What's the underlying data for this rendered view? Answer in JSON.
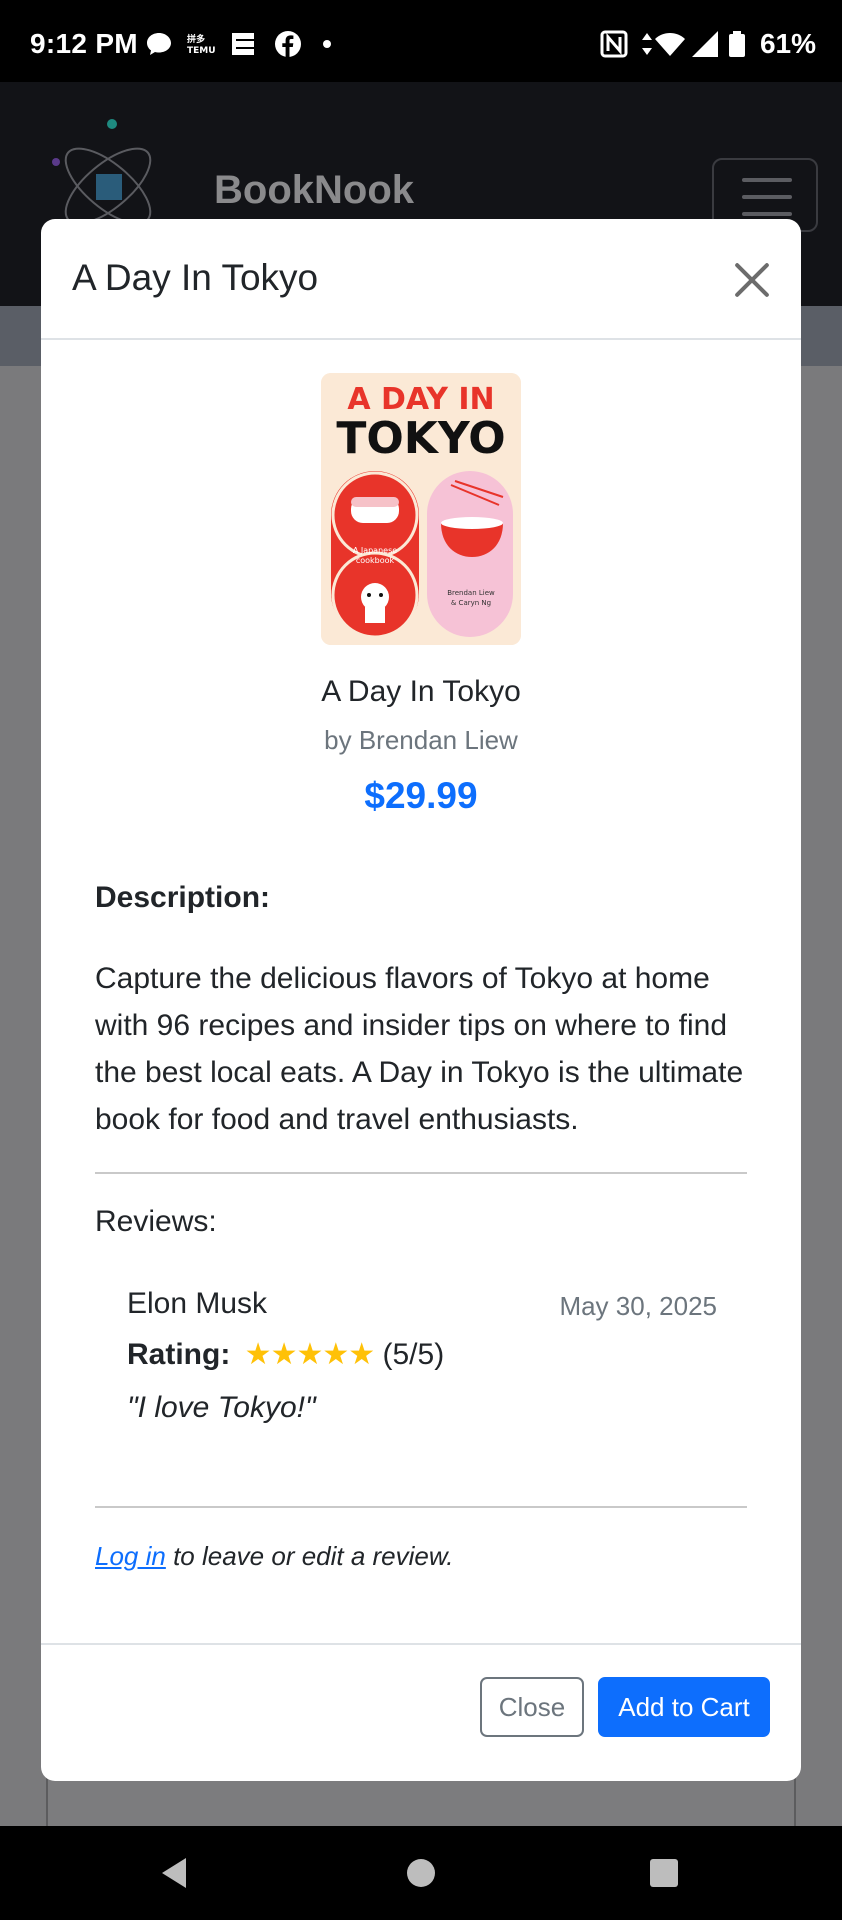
{
  "status_bar": {
    "time": "9:12 PM",
    "battery": "61%",
    "icons": [
      "chat-bubble-icon",
      "temu-icon",
      "news-icon",
      "facebook-icon",
      "dot-icon",
      "nfc-icon",
      "data-arrows-icon",
      "wifi-icon",
      "signal-icon",
      "battery-icon"
    ]
  },
  "app": {
    "brand": "BookNook"
  },
  "modal": {
    "title": "A Day In Tokyo",
    "book": {
      "cover_text_line1": "A DAY IN",
      "cover_text_line2": "TOKYO",
      "cover_small1": "A Japanese cookbook",
      "cover_small2": "Brendan Liew & Caryn Ng",
      "title": "A Day In Tokyo",
      "author": "by Brendan Liew",
      "price": "$29.99"
    },
    "description_label": "Description:",
    "description": "Capture the delicious flavors of Tokyo at home with 96 recipes and insider tips on where to find the best local eats. A Day in Tokyo is the ultimate book for food and travel enthusiasts.",
    "reviews_label": "Reviews:",
    "reviews": [
      {
        "name": "Elon Musk",
        "date": "May 30, 2025",
        "rating_label": "Rating:",
        "stars": "★★★★★",
        "rating_text": "(5/5)",
        "rating_value": 5,
        "text": "\"I love Tokyo!\""
      }
    ],
    "login_link": "Log in",
    "login_suffix": " to leave or edit a review.",
    "buttons": {
      "close": "Close",
      "add_to_cart": "Add to Cart"
    }
  },
  "colors": {
    "primary": "#0d6efd",
    "star": "#ffc107",
    "muted": "#6c757d"
  }
}
